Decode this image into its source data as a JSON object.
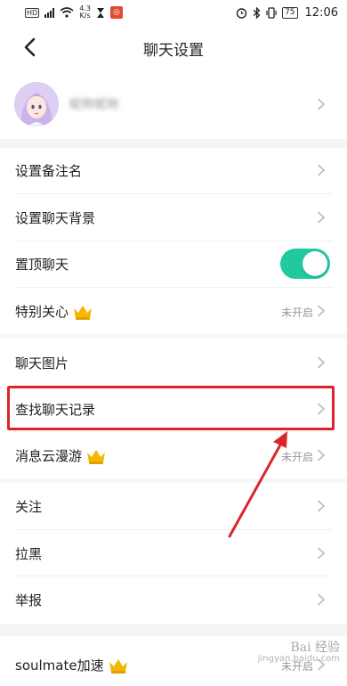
{
  "statusbar": {
    "hd": "HD",
    "net_speed_value": "4.3",
    "net_speed_unit": "K/s",
    "app_icon": "app-notification-icon",
    "battery": "75",
    "time": "12:06"
  },
  "navbar": {
    "back_icon": "chevron-left-icon",
    "title": "聊天设置"
  },
  "profile": {
    "name": "昵称昵称"
  },
  "rows": [
    {
      "label": "设置备注名"
    },
    {
      "label": "设置聊天背景"
    },
    {
      "label": "置顶聊天",
      "toggle": true
    },
    {
      "label": "特别关心",
      "crown": true,
      "status": "未开启"
    },
    {
      "label": "聊天图片"
    },
    {
      "label": "查找聊天记录"
    },
    {
      "label": "消息云漫游",
      "crown": true,
      "status": "未开启"
    },
    {
      "label": "关注"
    },
    {
      "label": "拉黑"
    },
    {
      "label": "举报"
    },
    {
      "label": "soulmate加速",
      "crown": true,
      "status": "未开启"
    }
  ],
  "colors": {
    "toggle_on": "#22c8a0",
    "annotation_red": "#d9262b",
    "crown_gold": "#f5b800"
  },
  "watermark": {
    "text": "Bai 经验",
    "sub": "jingyan.baidu.com"
  }
}
